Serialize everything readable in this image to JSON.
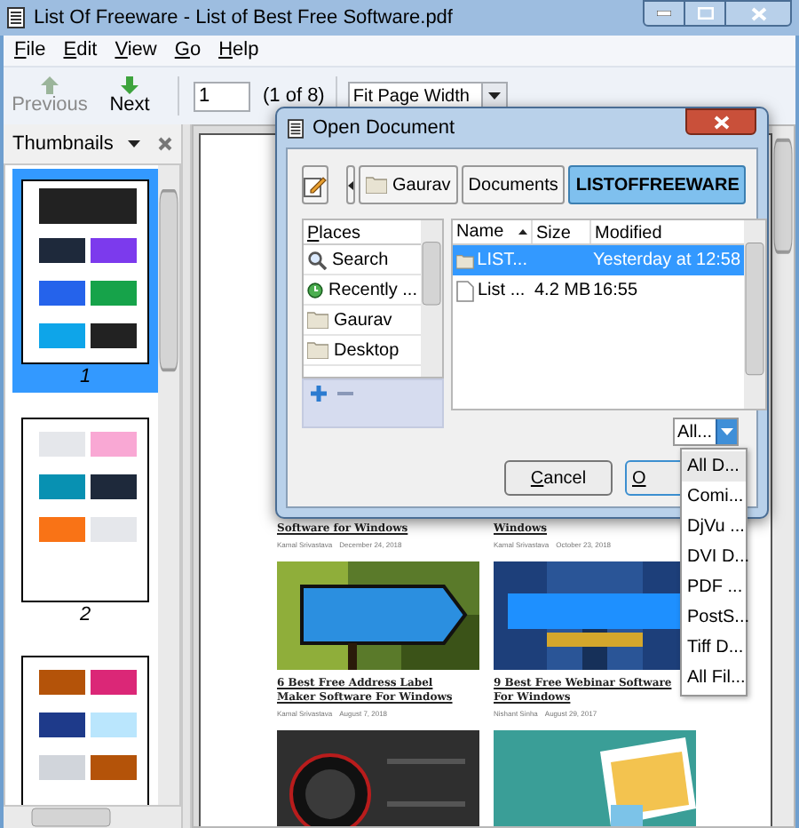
{
  "window": {
    "title": "List Of Freeware - List of Best Free Software.pdf"
  },
  "menu": [
    {
      "label": "File"
    },
    {
      "label": "Edit"
    },
    {
      "label": "View"
    },
    {
      "label": "Go"
    },
    {
      "label": "Help"
    }
  ],
  "toolbar": {
    "previous": {
      "label": "Previous",
      "disabled": true
    },
    "next": {
      "label": "Next",
      "disabled": false
    },
    "page_field": {
      "value": "1"
    },
    "page_count": "(1 of 8)",
    "zoom": {
      "value": "Fit Page Width"
    }
  },
  "thumbnails": {
    "title": "Thumbnails",
    "pages": [
      {
        "label": "1",
        "selected": true
      },
      {
        "label": "2",
        "selected": false
      },
      {
        "selected": false
      }
    ]
  },
  "document": {
    "rows": [
      {
        "kind": "captions",
        "items": [
          {
            "title": "Software for Windows",
            "author": "Kamal Srivastava",
            "date": "December 24, 2018"
          },
          {
            "title": "Windows",
            "author": "Kamal Srivastava",
            "date": "October 23, 2018"
          }
        ]
      },
      {
        "kind": "pictures",
        "items": [
          {
            "kind": "sign"
          },
          {
            "kind": "person"
          }
        ]
      },
      {
        "kind": "captions",
        "items": [
          {
            "title": "6 Best Free Address Label Maker Software For Windows",
            "author": "Kamal Srivastava",
            "date": "August 7, 2018"
          },
          {
            "title": "9 Best Free Webinar Software For Windows",
            "author": "Nishant Sinha",
            "date": "August 29, 2017"
          }
        ]
      },
      {
        "kind": "pictures",
        "items": [
          {
            "kind": "speaker"
          },
          {
            "kind": "envelope"
          }
        ]
      }
    ]
  },
  "dialog": {
    "title": "Open Document",
    "path": [
      {
        "label": "Gaurav",
        "selected": false
      },
      {
        "label": "Documents",
        "selected": false
      },
      {
        "label": "LISTOFFREEWARE",
        "selected": true
      }
    ],
    "places": {
      "header": "Places",
      "items": [
        {
          "label": "Search",
          "kind": "search"
        },
        {
          "label": "Recently ...",
          "kind": "recent"
        },
        {
          "label": "Gaurav",
          "kind": "folder"
        },
        {
          "label": "Desktop",
          "kind": "folder"
        }
      ]
    },
    "files": {
      "columns": [
        "Name",
        "Size",
        "Modified"
      ],
      "rows": [
        {
          "name": "LIST...",
          "kind": "folder",
          "modified": "Yesterday at 12:58",
          "selected": true
        },
        {
          "name": "List ...",
          "kind": "file",
          "size": "4.2 MB",
          "modified": "16:55",
          "selected": false
        }
      ]
    },
    "filter": {
      "value": "All..."
    },
    "buttons": [
      {
        "label": "Cancel"
      },
      {
        "label": "O"
      }
    ]
  },
  "filter_menu": {
    "items": [
      {
        "label": "All D...",
        "selected": true
      },
      {
        "label": "Comi...",
        "selected": false
      },
      {
        "label": "DjVu ...",
        "selected": false
      },
      {
        "label": "DVI D...",
        "selected": false
      },
      {
        "label": "PDF ...",
        "selected": false
      },
      {
        "label": "PostS...",
        "selected": false
      },
      {
        "label": "Tiff D...",
        "selected": false
      },
      {
        "label": "All Fil...",
        "selected": false
      }
    ]
  }
}
